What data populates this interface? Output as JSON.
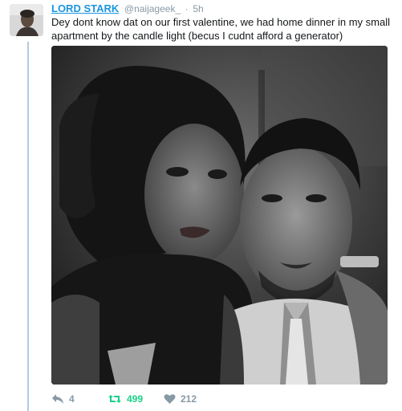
{
  "tweet": {
    "author_name": "LORD STARK",
    "author_handle": "@naijageek_",
    "separator": "·",
    "timestamp": "5h",
    "text": "Dey dont know dat on our first valentine, we had home dinner in my small apartment by the candle light (becus I cudnt afford a generator)",
    "photo_icon": "couple-selfie-photo",
    "actions": {
      "reply_icon": "reply-icon",
      "reply_count": "4",
      "retweet_icon": "retweet-icon",
      "retweet_count": "499",
      "like_icon": "heart-icon",
      "like_count": "212"
    }
  },
  "colors": {
    "link": "#1b95e0",
    "muted": "#8899a6",
    "retweet_active": "#19cf86",
    "thread_line": "#b0cbe0"
  }
}
